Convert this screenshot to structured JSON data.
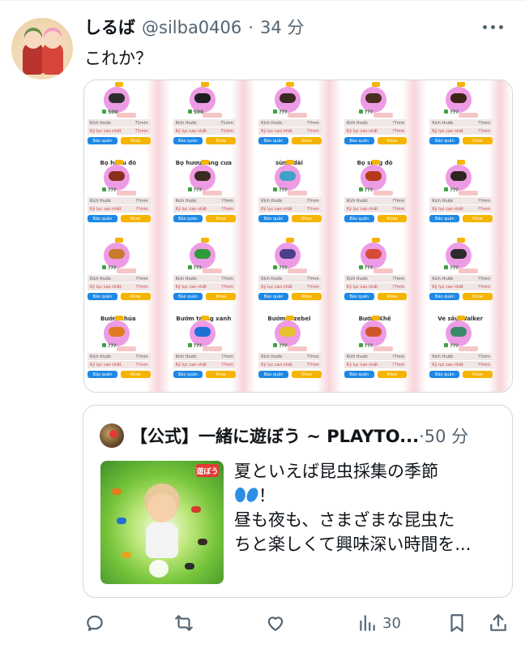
{
  "tweet": {
    "display_name": "しるば",
    "handle": "@silba0406",
    "separator": "·",
    "time": "34 分",
    "text": "これか？"
  },
  "media": {
    "cards": [
      {
        "title": "",
        "price": "500",
        "size_label": "Kích thước",
        "size": "71mm",
        "record_label": "Kỷ lục cao nhất",
        "record": "71mm",
        "left_btn": "Bảo quản",
        "right_btn": "Khoe",
        "bug_color": "#2d2d2d"
      },
      {
        "title": "",
        "price": "500",
        "size_label": "Kích thước",
        "size": "71mm",
        "record_label": "Kỷ lục cao nhất",
        "record": "71mm",
        "left_btn": "Bảo quản",
        "right_btn": "Khoe",
        "bug_color": "#1f1f1f"
      },
      {
        "title": "",
        "price": "???",
        "size_label": "Kích thước",
        "size": "??mm",
        "record_label": "Kỷ lục cao nhất",
        "record": "??mm",
        "left_btn": "Bảo quản",
        "right_btn": "Khoe",
        "bug_color": "#3a2a22"
      },
      {
        "title": "",
        "price": "???",
        "size_label": "Kích thước",
        "size": "??mm",
        "record_label": "Kỷ lục cao nhất",
        "record": "??mm",
        "left_btn": "Bảo quản",
        "right_btn": "Khoe",
        "bug_color": "#4a2e22"
      },
      {
        "title": "",
        "price": "???",
        "size_label": "Kích thước",
        "size": "??mm",
        "record_label": "Kỷ lục cao nhất",
        "record": "??mm",
        "left_btn": "Bảo quản",
        "right_btn": "Khoe",
        "bug_color": "#3c2418"
      },
      {
        "title": "Bọ hươu đỏ",
        "price": "???",
        "size_label": "Kích thước",
        "size": "??mm",
        "record_label": "Kỷ lục cao nhất",
        "record": "??mm",
        "left_btn": "Bảo quản",
        "right_btn": "Khoe",
        "bug_color": "#8a2f1c"
      },
      {
        "title": "Bọ hươu răng cưa",
        "price": "???",
        "size_label": "Kích thước",
        "size": "??mm",
        "record_label": "Kỷ lục cao nhất",
        "record": "??mm",
        "left_btn": "Bảo quản",
        "right_btn": "Khoe",
        "bug_color": "#3b2a1f"
      },
      {
        "title": "sừng dài",
        "price": "???",
        "size_label": "Kích thước",
        "size": "??mm",
        "record_label": "Kỷ lục cao nhất",
        "record": "??mm",
        "left_btn": "Bảo quản",
        "right_btn": "Khoe",
        "bug_color": "#3fa0c8"
      },
      {
        "title": "Bọ sừng đỏ",
        "price": "???",
        "size_label": "Kích thước",
        "size": "??mm",
        "record_label": "Kỷ lục cao nhất",
        "record": "??mm",
        "left_btn": "Bảo quản",
        "right_btn": "Khoe",
        "bug_color": "#b33a1a"
      },
      {
        "title": "",
        "price": "???",
        "size_label": "Kích thước",
        "size": "??mm",
        "record_label": "Kỷ lục cao nhất",
        "record": "??mm",
        "left_btn": "Bảo quản",
        "right_btn": "Khoe",
        "bug_color": "#2f2520"
      },
      {
        "title": "",
        "price": "???",
        "size_label": "Kích thước",
        "size": "??mm",
        "record_label": "Kỷ lục cao nhất",
        "record": "??mm",
        "left_btn": "Bảo quản",
        "right_btn": "Khoe",
        "bug_color": "#c97a2e"
      },
      {
        "title": "",
        "price": "???",
        "size_label": "Kích thước",
        "size": "??mm",
        "record_label": "Kỷ lục cao nhất",
        "record": "??mm",
        "left_btn": "Bảo quản",
        "right_btn": "Khoe",
        "bug_color": "#2f9a3a"
      },
      {
        "title": "",
        "price": "???",
        "size_label": "Kích thước",
        "size": "??mm",
        "record_label": "Kỷ lục cao nhất",
        "record": "??mm",
        "left_btn": "Bảo quản",
        "right_btn": "Khoe",
        "bug_color": "#4a3f8a"
      },
      {
        "title": "",
        "price": "???",
        "size_label": "Kích thước",
        "size": "??mm",
        "record_label": "Kỷ lục cao nhất",
        "record": "??mm",
        "left_btn": "Bảo quản",
        "right_btn": "Khoe",
        "bug_color": "#d64a3a"
      },
      {
        "title": "",
        "price": "???",
        "size_label": "Kích thước",
        "size": "??mm",
        "record_label": "Kỷ lục cao nhất",
        "record": "??mm",
        "left_btn": "Bảo quản",
        "right_btn": "Khoe",
        "bug_color": "#2b2b2b"
      },
      {
        "title": "Bướm chúa",
        "price": "???",
        "size_label": "Kích thước",
        "size": "??mm",
        "record_label": "Kỷ lục cao nhất",
        "record": "??mm",
        "left_btn": "Bảo quản",
        "right_btn": "Khoe",
        "bug_color": "#e07b1f"
      },
      {
        "title": "Bướm trắng xanh",
        "price": "???",
        "size_label": "Kích thước",
        "size": "??mm",
        "record_label": "Kỷ lục cao nhất",
        "record": "??mm",
        "left_btn": "Bảo quản",
        "right_btn": "Khoe",
        "bug_color": "#1f6fd6"
      },
      {
        "title": "Bướm Jezebel",
        "price": "???",
        "size_label": "Kích thước",
        "size": "??mm",
        "record_label": "Kỷ lục cao nhất",
        "record": "??mm",
        "left_btn": "Bảo quản",
        "right_btn": "Khoe",
        "bug_color": "#e6c22a"
      },
      {
        "title": "Bướm Khế",
        "price": "???",
        "size_label": "Kích thước",
        "size": "??mm",
        "record_label": "Kỷ lục cao nhất",
        "record": "??mm",
        "left_btn": "Bảo quản",
        "right_btn": "Khoe",
        "bug_color": "#d0552a"
      },
      {
        "title": "Ve sầu Walker",
        "price": "???",
        "size_label": "Kích thước",
        "size": "??mm",
        "record_label": "Kỷ lục cao nhất",
        "record": "??mm",
        "left_btn": "Bảo quản",
        "right_btn": "Khoe",
        "bug_color": "#3a8a6a"
      }
    ]
  },
  "quote": {
    "name": "【公式】一緒に遊ぼう ~ PLAYTO...",
    "separator": "·",
    "time": "50 分",
    "badge": "遊ぼう",
    "line1": "夏といえば昆虫採集の季節",
    "line2_suffix": "！",
    "line3": "昼も夜も、さまざまな昆虫た",
    "line4": "ちと楽しくて興味深い時間を..."
  },
  "actions": {
    "reply_icon": "reply-icon",
    "retweet_icon": "retweet-icon",
    "like_icon": "like-icon",
    "views_icon": "views-icon",
    "views_count": "30",
    "bookmark_icon": "bookmark-icon",
    "share_icon": "share-icon"
  },
  "colors": {
    "text": "#0f1419",
    "secondary": "#536471",
    "border": "#cfd9de",
    "card_circle": "#ee9be6",
    "btn_blue": "#1e88e5",
    "btn_yellow": "#f5b400"
  }
}
